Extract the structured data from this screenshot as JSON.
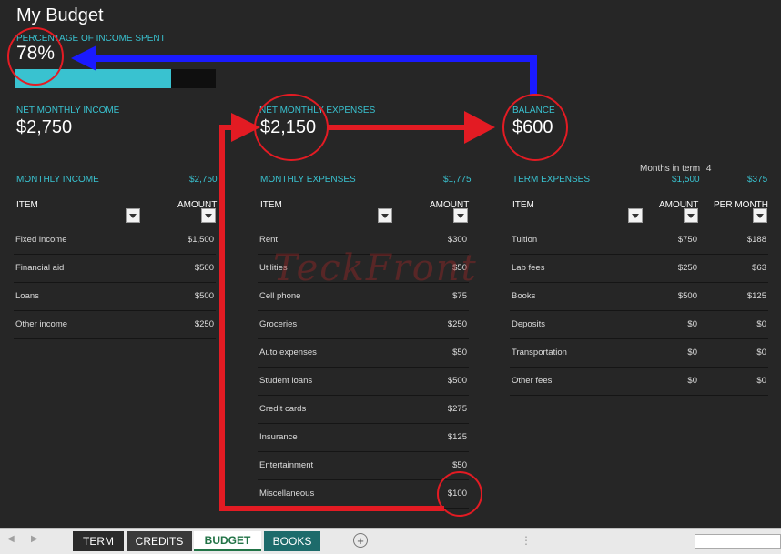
{
  "title": "My Budget",
  "percent": {
    "label": "PERCENTAGE OF INCOME SPENT",
    "value": "78%",
    "fill_fraction": 0.78
  },
  "net_income": {
    "label": "NET MONTHLY INCOME",
    "value": "$2,750"
  },
  "net_expenses": {
    "label": "NET MONTHLY EXPENSES",
    "value": "$2,150"
  },
  "balance": {
    "label": "BALANCE",
    "value": "$600"
  },
  "income": {
    "title": "MONTHLY INCOME",
    "total": "$2,750",
    "col_item": "ITEM",
    "col_amount": "AMOUNT",
    "rows": [
      {
        "label": "Fixed income",
        "amount": "$1,500"
      },
      {
        "label": "Financial aid",
        "amount": "$500"
      },
      {
        "label": "Loans",
        "amount": "$500"
      },
      {
        "label": "Other income",
        "amount": "$250"
      }
    ]
  },
  "expenses": {
    "title": "MONTHLY EXPENSES",
    "total": "$1,775",
    "col_item": "ITEM",
    "col_amount": "AMOUNT",
    "rows": [
      {
        "label": "Rent",
        "amount": "$300"
      },
      {
        "label": "Utilities",
        "amount": "$50"
      },
      {
        "label": "Cell phone",
        "amount": "$75"
      },
      {
        "label": "Groceries",
        "amount": "$250"
      },
      {
        "label": "Auto expenses",
        "amount": "$50"
      },
      {
        "label": "Student loans",
        "amount": "$500"
      },
      {
        "label": "Credit cards",
        "amount": "$275"
      },
      {
        "label": "Insurance",
        "amount": "$125"
      },
      {
        "label": "Entertainment",
        "amount": "$50"
      },
      {
        "label": "Miscellaneous",
        "amount": "$100"
      }
    ]
  },
  "term": {
    "months_label": "Months in term",
    "months_value": "4",
    "title": "TERM EXPENSES",
    "total_amount": "$1,500",
    "total_per_month": "$375",
    "col_item": "ITEM",
    "col_amount": "AMOUNT",
    "col_per_month": "PER MONTH",
    "rows": [
      {
        "label": "Tuition",
        "amount": "$750",
        "per_month": "$188"
      },
      {
        "label": "Lab fees",
        "amount": "$250",
        "per_month": "$63"
      },
      {
        "label": "Books",
        "amount": "$500",
        "per_month": "$125"
      },
      {
        "label": "Deposits",
        "amount": "$0",
        "per_month": "$0"
      },
      {
        "label": "Transportation",
        "amount": "$0",
        "per_month": "$0"
      },
      {
        "label": "Other fees",
        "amount": "$0",
        "per_month": "$0"
      }
    ]
  },
  "watermark": "TeckFront",
  "tabs": [
    {
      "label": "TERM"
    },
    {
      "label": "CREDITS"
    },
    {
      "label": "BUDGET"
    },
    {
      "label": "BOOKS"
    }
  ],
  "tab_colors": {
    "term_bg": "#2a2a2a",
    "credits_bg": "#3a3a3a",
    "budget_bg": "#ffffff",
    "books_bg": "#1d6b6b",
    "budget_text": "#217346"
  },
  "colors": {
    "accent": "#39c2d0",
    "annotation_red": "#e31b23",
    "annotation_blue": "#1a1aff",
    "background": "#262626"
  },
  "icons": {
    "add_sheet": "+",
    "nav_prev": "◀",
    "nav_next": "▶"
  }
}
